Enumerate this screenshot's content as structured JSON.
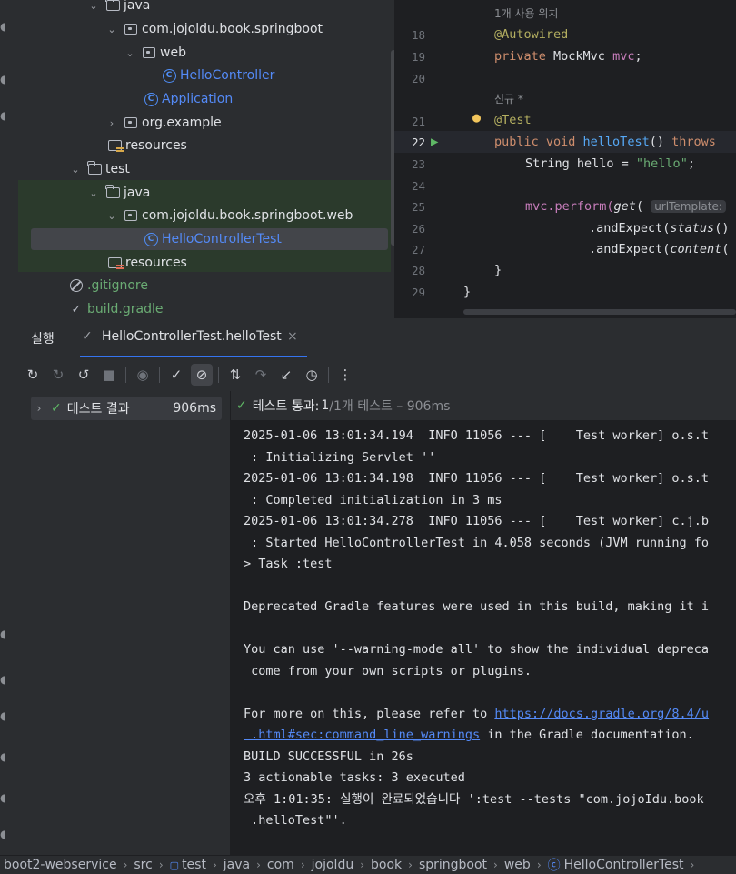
{
  "tree": {
    "items": [
      {
        "label": "java"
      },
      {
        "label": "com.jojoldu.book.springboot"
      },
      {
        "label": "web"
      },
      {
        "label": "HelloController"
      },
      {
        "label": "Application"
      },
      {
        "label": "org.example"
      },
      {
        "label": "resources"
      },
      {
        "label": "test"
      },
      {
        "label": "java"
      },
      {
        "label": "com.jojoldu.book.springboot.web"
      },
      {
        "label": "HelloControllerTest"
      },
      {
        "label": "resources"
      },
      {
        "label": ".gitignore"
      },
      {
        "label": "build.gradle"
      }
    ]
  },
  "editor": {
    "usage_hint": "1개 사용 위치",
    "new_hint": "신규 *",
    "lines": {
      "n18": "18",
      "n19": "19",
      "n20": "20",
      "n21": "21",
      "n22": "22",
      "n23": "23",
      "n24": "24",
      "n25": "25",
      "n26": "26",
      "n27": "27",
      "n28": "28",
      "n29": "29"
    },
    "code": {
      "autowired": "@Autowired",
      "private_kw": "private",
      "mockmvc_type": " MockMvc ",
      "mvc_field": "mvc",
      "semicolon": ";",
      "test_ann": "@Test",
      "public_void": "public void ",
      "hello_test": "helloTest",
      "parens_throws_pre": "() ",
      "throws_kw": "throws",
      "string_decl": "String hello = ",
      "hello_str": "\"hello\"",
      "mvc_perform_a": "mvc.perform(",
      "get_fn": "get",
      "paren_open": "( ",
      "url_template_hint": "urlTemplate:",
      "and_expect1_a": ".andExpect(",
      "status_fn": "status",
      "and_expect1_b": "()",
      "and_expect2_a": ".andExpect(",
      "content_fn": "content",
      "and_expect2_b": "(",
      "close_inner": "}",
      "close_outer": "}"
    }
  },
  "run": {
    "tab_run": "실행",
    "tab_test": "HelloControllerTest.helloTest",
    "tab_close": "×",
    "results_label": "테스트 결과",
    "results_time": "906ms",
    "summary_prefix": "테스트 통과:",
    "summary_count": "1",
    "summary_total": "/1개 테스트 – 906ms",
    "console": {
      "l1": "2025-01-06 13:01:34.194  INFO 11056 --- [    Test worker] o.s.t",
      "l2": " : Initializing Servlet ''",
      "l3": "2025-01-06 13:01:34.198  INFO 11056 --- [    Test worker] o.s.t",
      "l4": " : Completed initialization in 3 ms",
      "l5": "2025-01-06 13:01:34.278  INFO 11056 --- [    Test worker] c.j.b",
      "l6": " : Started HelloControllerTest in 4.058 seconds (JVM running fo",
      "l7": "> Task :test",
      "l8": "",
      "l9": "Deprecated Gradle features were used in this build, making it i",
      "l10": "",
      "l11": "You can use '--warning-mode all' to show the individual depreca",
      "l12": " come from your own scripts or plugins.",
      "l13": "",
      "l14_pre": "For more on this, please refer to ",
      "l14_link": "https://docs.gradle.org/8.4/u",
      "l15_link": " .html#sec:command_line_warnings",
      "l15_post": " in the Gradle documentation.",
      "l16": "BUILD SUCCESSFUL in 26s",
      "l17": "3 actionable tasks: 3 executed",
      "l18": "오후 1:01:35: 실행이 완료되었습니다 ':test --tests \"com.jojoIdu.book",
      "l19": " .helloTest\"'."
    }
  },
  "breadcrumb": {
    "items": [
      "boot2-webservice",
      "src",
      "test",
      "java",
      "com",
      "jojoldu",
      "book",
      "springboot",
      "web",
      "HelloControllerTest"
    ]
  }
}
